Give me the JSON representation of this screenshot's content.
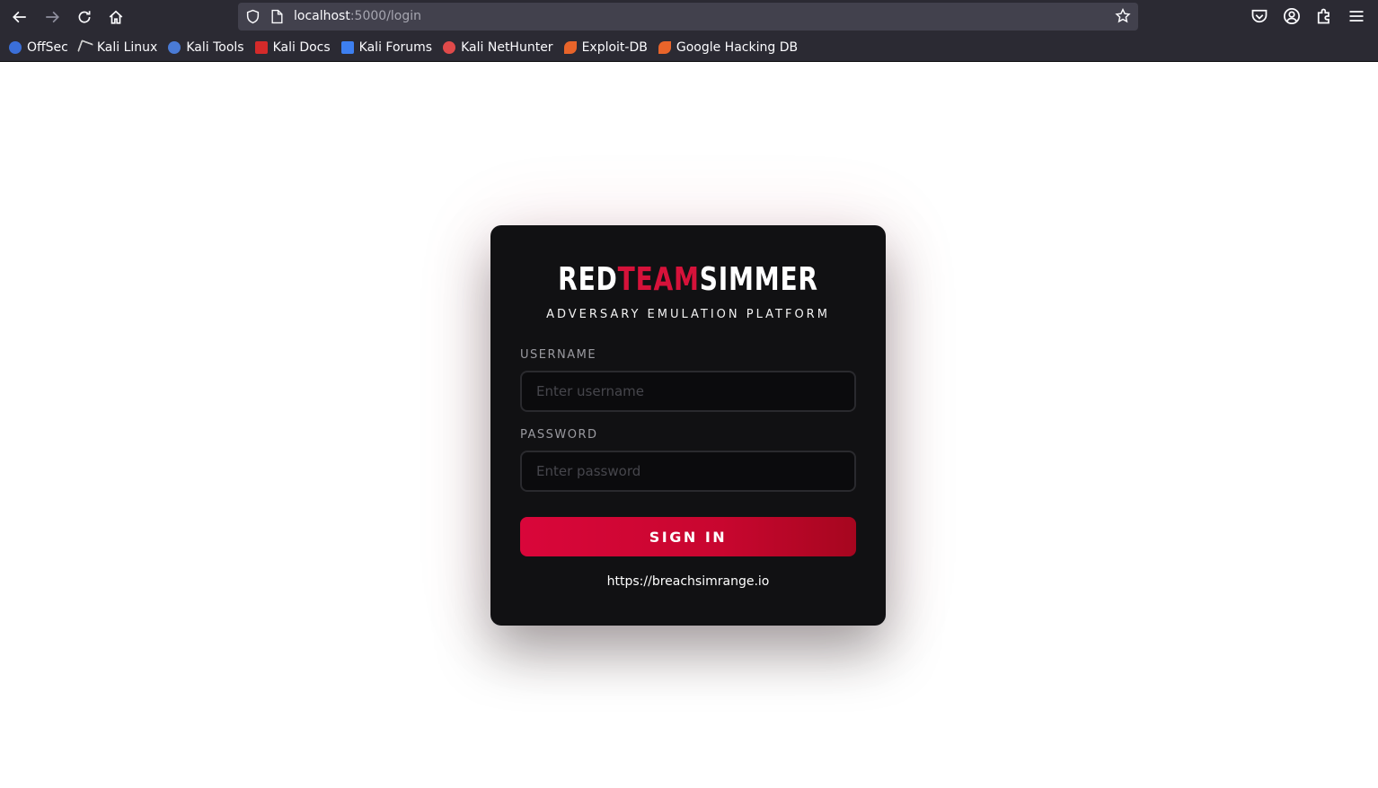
{
  "browser": {
    "url_host": "localhost",
    "url_path": ":5000/login",
    "bookmarks": [
      {
        "label": "OffSec",
        "color": "#3b6fd8"
      },
      {
        "label": "Kali Linux",
        "color": "#ffffff"
      },
      {
        "label": "Kali Tools",
        "color": "#4a7bd6"
      },
      {
        "label": "Kali Docs",
        "color": "#d42a2a"
      },
      {
        "label": "Kali Forums",
        "color": "#3d7ff0"
      },
      {
        "label": "Kali NetHunter",
        "color": "#e04a4a"
      },
      {
        "label": "Exploit-DB",
        "color": "#e8642a"
      },
      {
        "label": "Google Hacking DB",
        "color": "#e8642a"
      }
    ]
  },
  "login": {
    "logo_part1": "RED",
    "logo_part2": "TEAM",
    "logo_part3": "SIMMER",
    "subtitle": "ADVERSARY EMULATION PLATFORM",
    "username_label": "USERNAME",
    "username_placeholder": "Enter username",
    "password_label": "PASSWORD",
    "password_placeholder": "Enter password",
    "signin_label": "SIGN IN",
    "link_text": "https://breachsimrange.io"
  },
  "colors": {
    "accent": "#d6123a",
    "card_bg": "#111113"
  }
}
